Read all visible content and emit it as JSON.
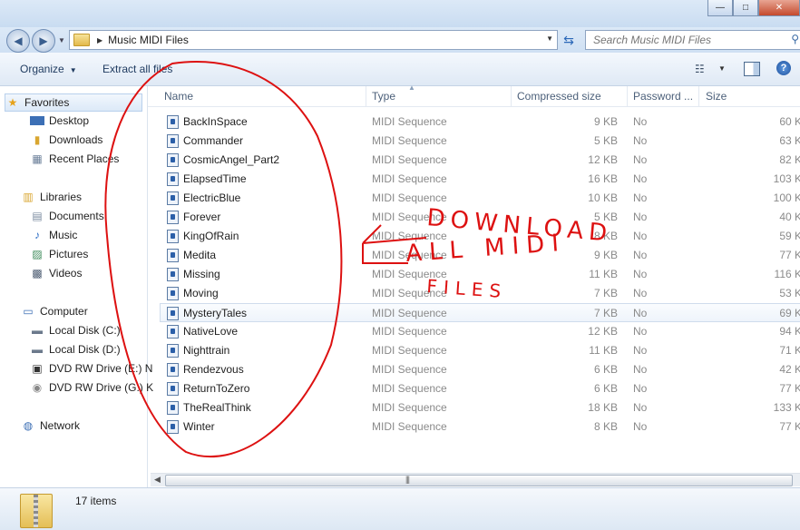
{
  "window": {
    "minimize_glyph": "—",
    "maximize_glyph": "□",
    "close_glyph": "✕"
  },
  "address": {
    "breadcrumb": "Music MIDI Files",
    "search_placeholder": "Search Music MIDI Files"
  },
  "toolbar": {
    "organize": "Organize",
    "extract": "Extract all files"
  },
  "nav": {
    "favorites": "Favorites",
    "desktop": "Desktop",
    "downloads": "Downloads",
    "recent": "Recent Places",
    "libraries": "Libraries",
    "documents": "Documents",
    "music": "Music",
    "pictures": "Pictures",
    "videos": "Videos",
    "computer": "Computer",
    "local_c": "Local Disk (C:)",
    "local_d": "Local Disk (D:)",
    "dvd_e": "DVD RW Drive (E:) N",
    "dvd_g": "DVD RW Drive (G:) K",
    "network": "Network"
  },
  "columns": {
    "name": "Name",
    "type": "Type",
    "compressed": "Compressed size",
    "password": "Password ...",
    "size": "Size"
  },
  "files": [
    {
      "name": "BackInSpace",
      "type": "MIDI Sequence",
      "compressed": "9 KB",
      "password": "No",
      "size": "60 K"
    },
    {
      "name": "Commander",
      "type": "MIDI Sequence",
      "compressed": "5 KB",
      "password": "No",
      "size": "63 K"
    },
    {
      "name": "CosmicAngel_Part2",
      "type": "MIDI Sequence",
      "compressed": "12 KB",
      "password": "No",
      "size": "82 K"
    },
    {
      "name": "ElapsedTime",
      "type": "MIDI Sequence",
      "compressed": "16 KB",
      "password": "No",
      "size": "103 K"
    },
    {
      "name": "ElectricBlue",
      "type": "MIDI Sequence",
      "compressed": "10 KB",
      "password": "No",
      "size": "100 K"
    },
    {
      "name": "Forever",
      "type": "MIDI Sequence",
      "compressed": "5 KB",
      "password": "No",
      "size": "40 K"
    },
    {
      "name": "KingOfRain",
      "type": "MIDI Sequence",
      "compressed": "8 KB",
      "password": "No",
      "size": "59 K"
    },
    {
      "name": "Medita",
      "type": "MIDI Sequence",
      "compressed": "9 KB",
      "password": "No",
      "size": "77 K"
    },
    {
      "name": "Missing",
      "type": "MIDI Sequence",
      "compressed": "11 KB",
      "password": "No",
      "size": "116 K"
    },
    {
      "name": "Moving",
      "type": "MIDI Sequence",
      "compressed": "7 KB",
      "password": "No",
      "size": "53 K"
    },
    {
      "name": "MysteryTales",
      "type": "MIDI Sequence",
      "compressed": "7 KB",
      "password": "No",
      "size": "69 K"
    },
    {
      "name": "NativeLove",
      "type": "MIDI Sequence",
      "compressed": "12 KB",
      "password": "No",
      "size": "94 K"
    },
    {
      "name": "Nighttrain",
      "type": "MIDI Sequence",
      "compressed": "11 KB",
      "password": "No",
      "size": "71 K"
    },
    {
      "name": "Rendezvous",
      "type": "MIDI Sequence",
      "compressed": "6 KB",
      "password": "No",
      "size": "42 K"
    },
    {
      "name": "ReturnToZero",
      "type": "MIDI Sequence",
      "compressed": "6 KB",
      "password": "No",
      "size": "77 K"
    },
    {
      "name": "TheRealThink",
      "type": "MIDI Sequence",
      "compressed": "18 KB",
      "password": "No",
      "size": "133 K"
    },
    {
      "name": "Winter",
      "type": "MIDI Sequence",
      "compressed": "8 KB",
      "password": "No",
      "size": "77 K"
    }
  ],
  "status": {
    "count": "17 items"
  },
  "annotation": {
    "line1": "DOWNLOAD",
    "line2": "ALL MIDI",
    "line3": "FILES",
    "color": "#dd1111"
  }
}
